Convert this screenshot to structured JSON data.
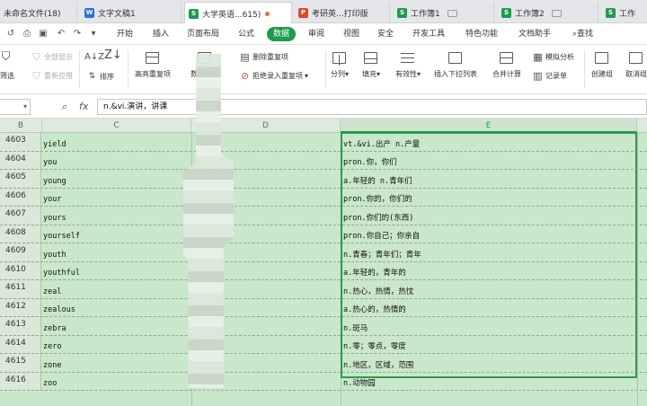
{
  "tabs": [
    {
      "label": "未命名文件(18)",
      "icon": "doc-icon",
      "color": "#888888",
      "active": false
    },
    {
      "label": "文字文稿1",
      "icon": "word-icon",
      "color": "#2f6fd6",
      "active": false
    },
    {
      "label": "大学英语...615)",
      "icon": "sheet-icon",
      "color": "#1e9b4c",
      "active": true
    },
    {
      "label": "考研英...打印版",
      "icon": "pdf-icon",
      "color": "#e0442c",
      "active": false
    },
    {
      "label": "工作簿1",
      "icon": "sheet-icon",
      "color": "#1e9b4c",
      "active": false
    },
    {
      "label": "工作簿2",
      "icon": "sheet-icon",
      "color": "#1e9b4c",
      "active": false
    },
    {
      "label": "工作",
      "icon": "sheet-icon",
      "color": "#1e9b4c",
      "active": false
    }
  ],
  "menu": {
    "items": [
      "开始",
      "插入",
      "页面布局",
      "公式",
      "数据",
      "审阅",
      "视图",
      "安全",
      "开发工具",
      "特色功能",
      "文档助手"
    ],
    "active": "数据",
    "search": "查找"
  },
  "ribbon": {
    "filter_all": "全部显示",
    "reapply": "重新应用",
    "auto_filter": "筛选",
    "sort": "排序",
    "highlight_dup": "高亮重复项",
    "data_compare": "数据对比",
    "remove_dup": "删除重复项",
    "reject_dup": "拒绝录入重复项",
    "split": "分列",
    "fill": "填充",
    "validity": "有效性",
    "dropdown": "插入下拉列表",
    "merge_calc": "合并计算",
    "simulate": "模拟分析",
    "record": "记录单",
    "create_group": "创建组",
    "ungroup": "取消组"
  },
  "formula": {
    "namebox": "",
    "fx": "fx",
    "value": "n.&vi.演讲，讲课"
  },
  "grid": {
    "columns": [
      "B",
      "C",
      "D",
      "E"
    ],
    "rows": [
      {
        "num": "4603",
        "word": "yield",
        "def": "vt.&vi.出产 n.产量"
      },
      {
        "num": "4604",
        "word": "you",
        "def": "pron.你，你们"
      },
      {
        "num": "4605",
        "word": "young",
        "def": "a.年轻的 n.青年们"
      },
      {
        "num": "4606",
        "word": "your",
        "def": "pron.你的，你们的"
      },
      {
        "num": "4607",
        "word": "yours",
        "def": "pron.你们的(东西)"
      },
      {
        "num": "4608",
        "word": "yourself",
        "def": "pron.你自己；你亲自"
      },
      {
        "num": "4609",
        "word": "youth",
        "def": "n.青春；青年们；青年"
      },
      {
        "num": "4610",
        "word": "youthful",
        "def": "a.年轻的，青年的"
      },
      {
        "num": "4611",
        "word": "zeal",
        "def": "n.热心，热情，热忱"
      },
      {
        "num": "4612",
        "word": "zealous",
        "def": "a.热心的，热情的"
      },
      {
        "num": "4613",
        "word": "zebra",
        "def": "n.斑马"
      },
      {
        "num": "4614",
        "word": "zero",
        "def": "n.零；零点，零度"
      },
      {
        "num": "4615",
        "word": "zone",
        "def": "n.地区，区域，范围"
      },
      {
        "num": "4616",
        "word": "zoo",
        "def": "n.动物园"
      }
    ]
  },
  "colors": {
    "accent": "#1e9b4c",
    "grid_bg": "#c9e7cb"
  }
}
